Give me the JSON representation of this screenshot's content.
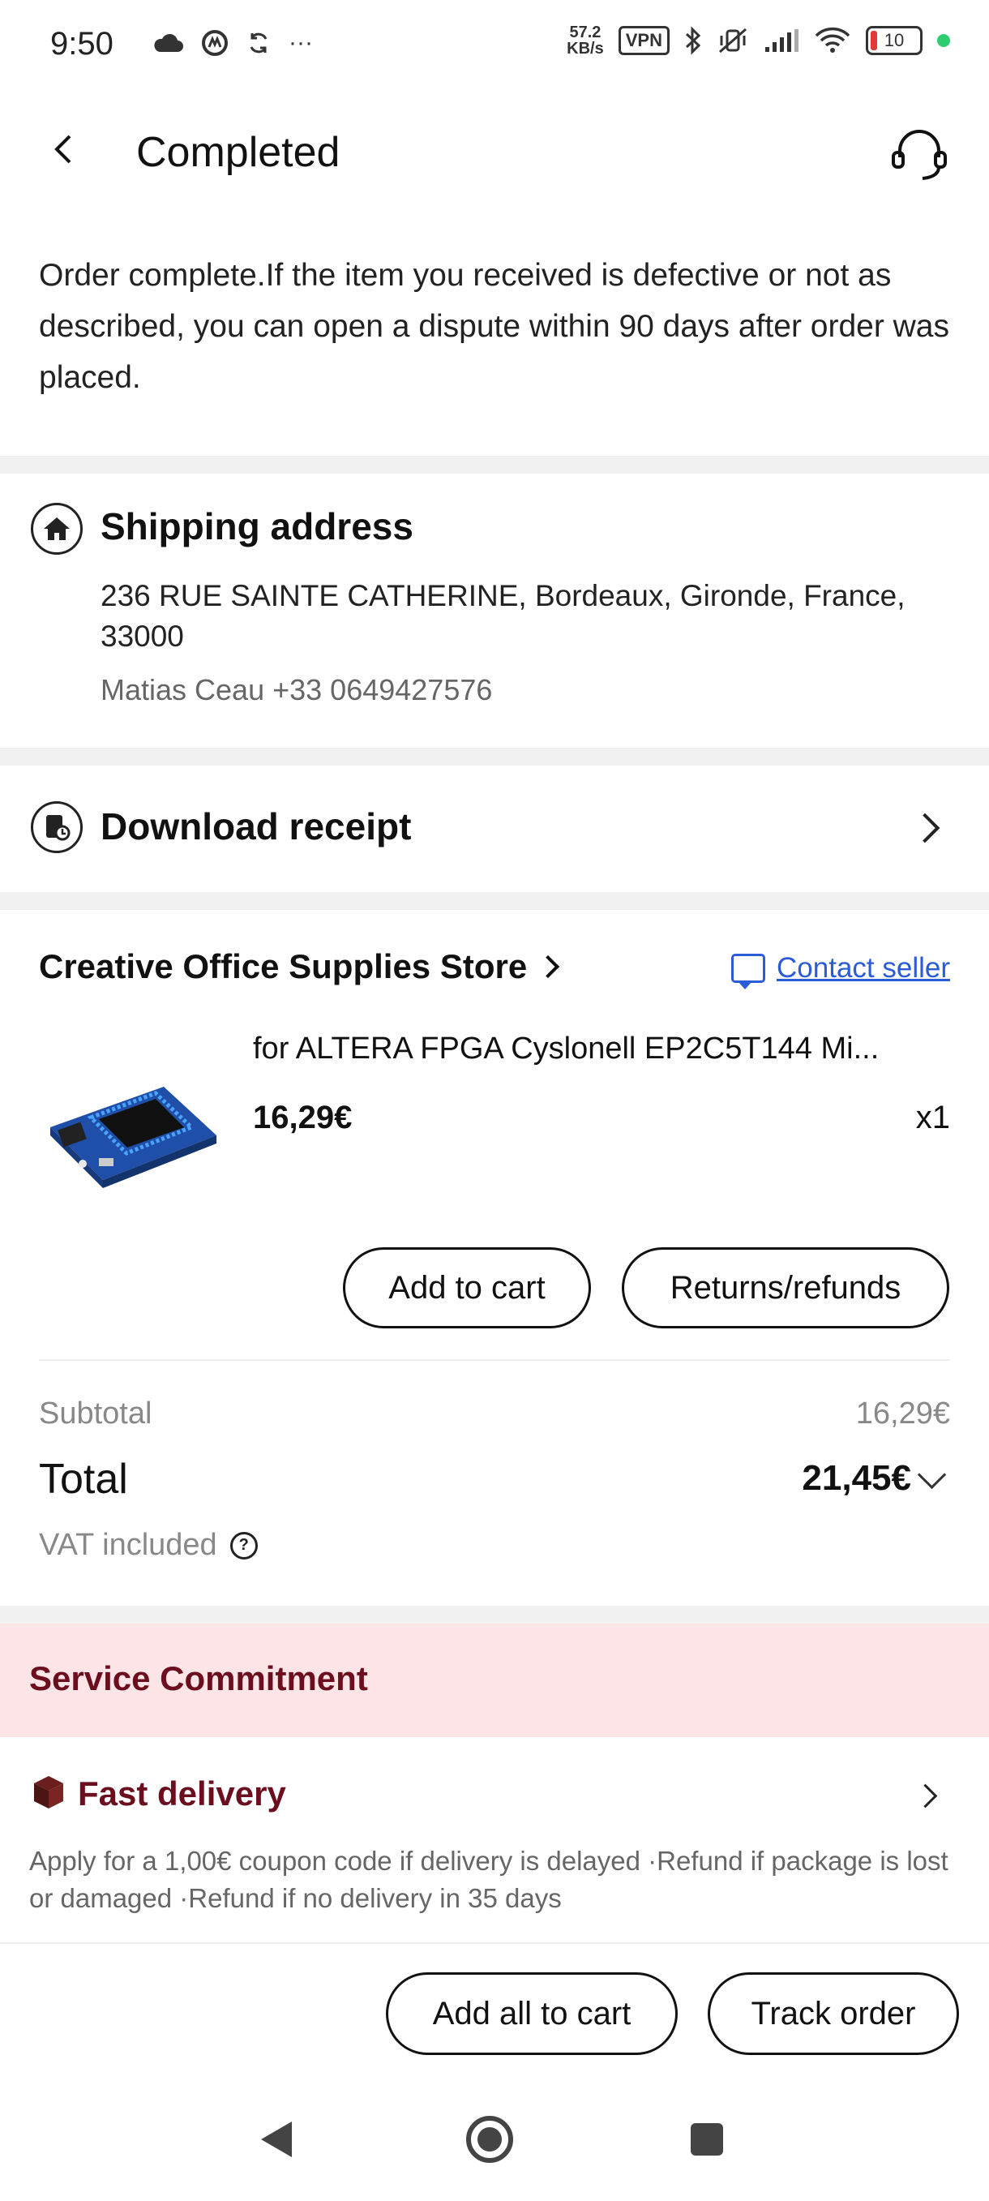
{
  "status_bar": {
    "time": "9:50",
    "more": "···",
    "speed_value": "57.2",
    "speed_unit": "KB/s",
    "vpn": "VPN",
    "battery": "10"
  },
  "header": {
    "title": "Completed"
  },
  "notice": {
    "text": "Order complete.If the item you received is defective or not as described, you can open a dispute within 90 days after order was placed."
  },
  "shipping": {
    "title": "Shipping address",
    "address": "236 RUE SAINTE CATHERINE, Bordeaux, Gironde, France, 33000",
    "contact": "Matias Ceau +33 0649427576"
  },
  "receipt": {
    "title": "Download receipt"
  },
  "store": {
    "name": "Creative Office Supplies Store",
    "contact_label": "Contact seller"
  },
  "product": {
    "title": "for ALTERA FPGA Cyslonell EP2C5T144 Mi...",
    "price": "16,29€",
    "quantity": "x1",
    "add_to_cart": "Add to cart",
    "returns": "Returns/refunds"
  },
  "summary": {
    "subtotal_label": "Subtotal",
    "subtotal_value": "16,29€",
    "total_label": "Total",
    "total_value": "21,45€",
    "vat_label": "VAT included"
  },
  "service": {
    "title": "Service Commitment",
    "fast_title": "Fast delivery",
    "fast_desc": "Apply for a 1,00€ coupon code if delivery is delayed ·Refund if package is lost or damaged ·Refund if no delivery in 35 days"
  },
  "bottom": {
    "add_all": "Add all to cart",
    "track": "Track order"
  },
  "colors": {
    "accent_dark_red": "#6b0f1e",
    "link_blue": "#2b5bd7",
    "commit_band": "#fde4e7"
  }
}
